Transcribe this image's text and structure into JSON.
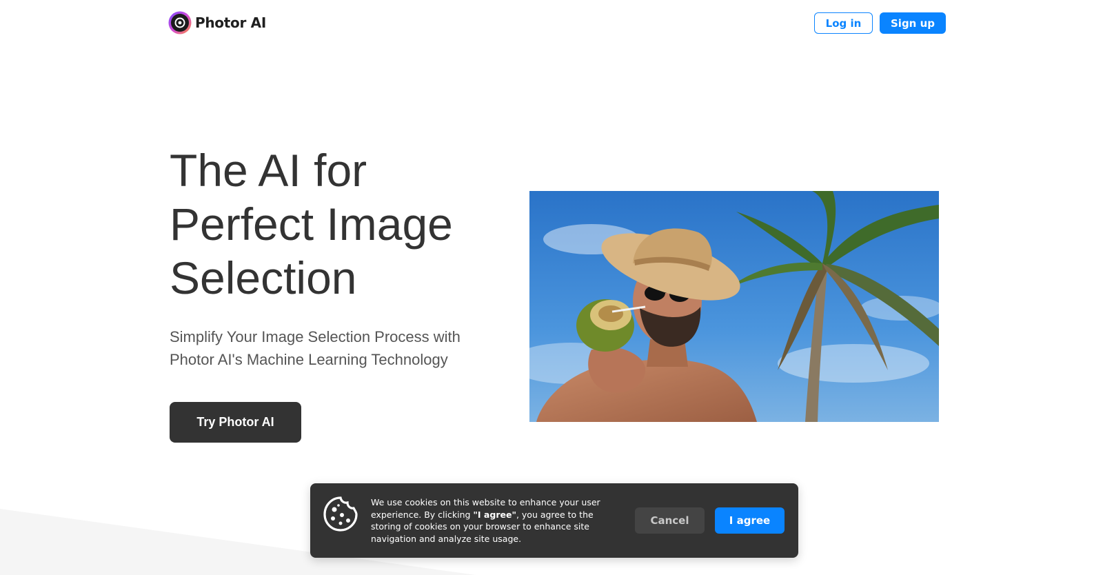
{
  "brand": {
    "name": "Photor AI",
    "accent_color": "#0a84ff",
    "dark_color": "#333333"
  },
  "header": {
    "login_label": "Log in",
    "signup_label": "Sign up"
  },
  "hero": {
    "title_lines": [
      "The AI for",
      "Perfect Image",
      "Selection"
    ],
    "subtitle_lines": [
      "Simplify Your Image Selection Process with",
      "Photor AI's Machine Learning Technology"
    ],
    "cta_label": "Try Photor AI",
    "image_icon": "photo-man-with-coconut-under-palm-tree"
  },
  "cookie_banner": {
    "icon": "cookie-icon",
    "text_before": "We use cookies on this website to enhance your user experience. By clicking ",
    "text_emphasis": "\"I agree\"",
    "text_after": ", you agree to the storing of cookies on your browser to enhance site navigation and analyze site usage.",
    "cancel_label": "Cancel",
    "agree_label": "I agree"
  }
}
